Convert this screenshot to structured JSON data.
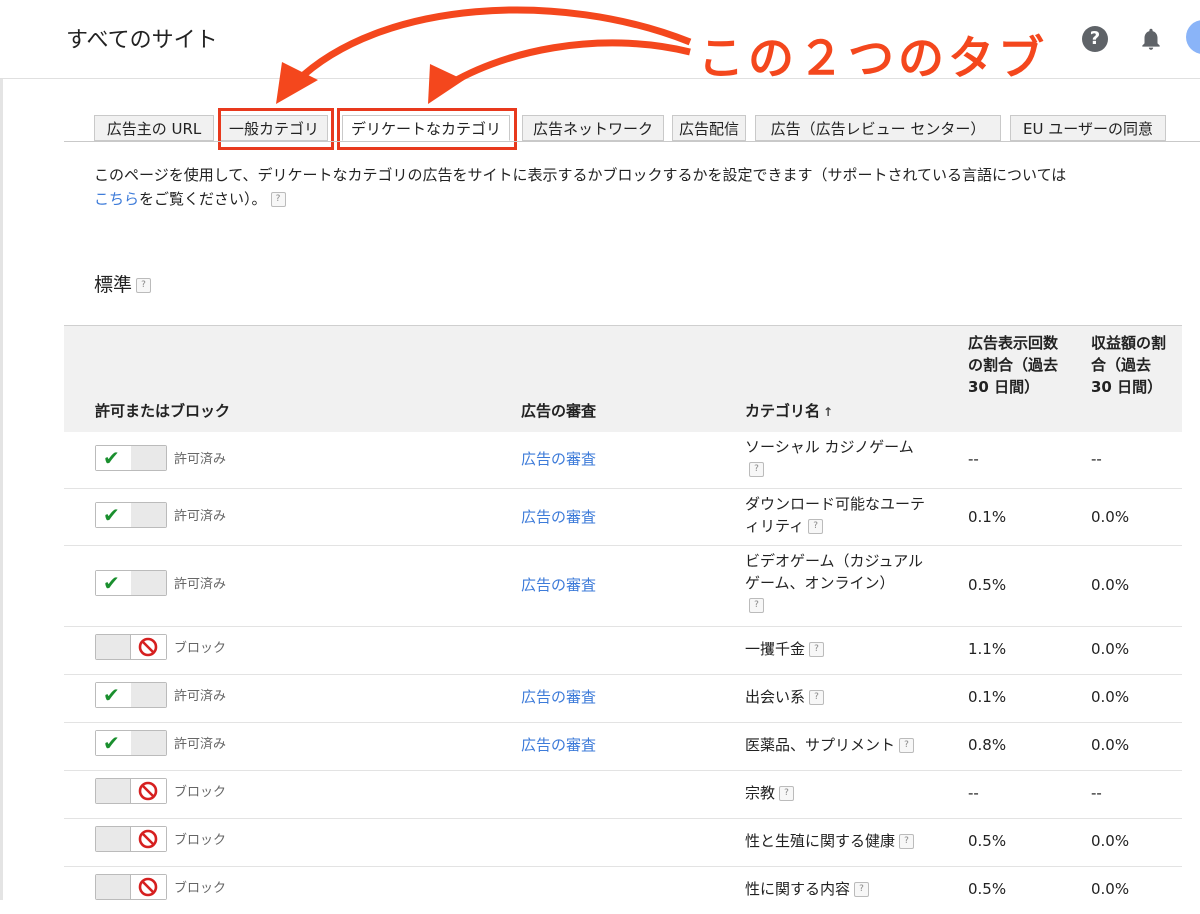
{
  "header": {
    "title": "すべてのサイト"
  },
  "annotation": {
    "text": "この２つのタブ"
  },
  "tabs": [
    {
      "label": "広告主の URL"
    },
    {
      "label": "一般カテゴリ"
    },
    {
      "label": "デリケートなカテゴリ"
    },
    {
      "label": "広告ネットワーク"
    },
    {
      "label": "広告配信"
    },
    {
      "label": "広告（広告レビュー センター）"
    },
    {
      "label": "EU ユーザーの同意"
    }
  ],
  "description": {
    "text": "このページを使用して、デリケートなカテゴリの広告をサイトに表示するかブロックするかを設定できます（サポートされている言語については",
    "link": "こちら",
    "suffix": "をご覧ください）。"
  },
  "section": {
    "title": "標準"
  },
  "table": {
    "headers": {
      "allow_block": "許可またはブロック",
      "review": "広告の審査",
      "category": "カテゴリ名",
      "sort_indicator": "↑",
      "impressions": "広告表示回数の割合（過去 30 日間）",
      "revenue": "収益額の割合（過去 30 日間）"
    },
    "rows": [
      {
        "status": "許可済み",
        "state": "allowed",
        "review": "広告の審査",
        "category": "ソーシャル カジノゲーム",
        "impressions": "--",
        "revenue": "--"
      },
      {
        "status": "許可済み",
        "state": "allowed",
        "review": "広告の審査",
        "category": "ダウンロード可能なユーティリティ",
        "impressions": "0.1%",
        "revenue": "0.0%"
      },
      {
        "status": "許可済み",
        "state": "allowed",
        "review": "広告の審査",
        "category": "ビデオゲーム（カジュアル ゲーム、オンライン）",
        "impressions": "0.5%",
        "revenue": "0.0%"
      },
      {
        "status": "ブロック",
        "state": "blocked",
        "review": "",
        "category": "一攫千金",
        "impressions": "1.1%",
        "revenue": "0.0%"
      },
      {
        "status": "許可済み",
        "state": "allowed",
        "review": "広告の審査",
        "category": "出会い系",
        "impressions": "0.1%",
        "revenue": "0.0%"
      },
      {
        "status": "許可済み",
        "state": "allowed",
        "review": "広告の審査",
        "category": "医薬品、サプリメント",
        "impressions": "0.8%",
        "revenue": "0.0%"
      },
      {
        "status": "ブロック",
        "state": "blocked",
        "review": "",
        "category": "宗教",
        "impressions": "--",
        "revenue": "--"
      },
      {
        "status": "ブロック",
        "state": "blocked",
        "review": "",
        "category": "性と生殖に関する健康",
        "impressions": "0.5%",
        "revenue": "0.0%"
      },
      {
        "status": "ブロック",
        "state": "blocked",
        "review": "",
        "category": "性に関する内容",
        "impressions": "0.5%",
        "revenue": "0.0%"
      }
    ]
  },
  "colors": {
    "accent_annotation": "#f4471d",
    "link": "#3d7bd9",
    "check": "#1a8f2e",
    "block": "#d62020"
  },
  "icons": [
    "help-icon",
    "bell-icon",
    "check-icon",
    "no-entry-icon",
    "help-small-icon",
    "sort-up-icon"
  ]
}
